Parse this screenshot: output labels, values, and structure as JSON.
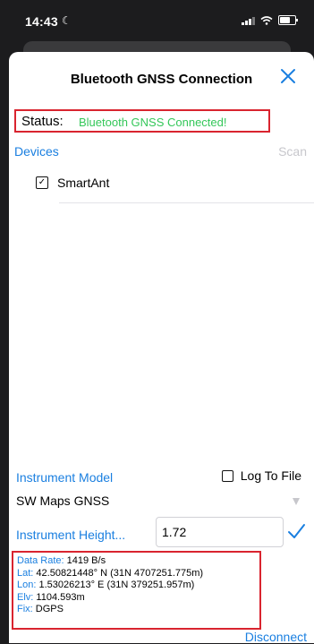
{
  "status_bar": {
    "time": "14:43"
  },
  "dialog": {
    "title": "Bluetooth GNSS Connection",
    "status_label": "Status:",
    "status_value": "Bluetooth GNSS Connected!",
    "devices_label": "Devices",
    "scan_label": "Scan",
    "devices": [
      {
        "name": "SmartAnt",
        "checked": true
      }
    ],
    "instrument_model_label": "Instrument Model",
    "log_to_file_label": "Log To File",
    "log_to_file_checked": false,
    "instrument_model_value": "SW Maps GNSS",
    "instrument_height_label": "Instrument Height...",
    "instrument_height_value": "1.72",
    "data": {
      "data_rate_label": "Data Rate:",
      "data_rate_value": "1419 B/s",
      "lat_label": "Lat:",
      "lat_value": "42.50821448° N (31N 4707251.775m)",
      "lon_label": "Lon:",
      "lon_value": "1.53026213° E (31N 379251.957m)",
      "elv_label": "Elv:",
      "elv_value": "1104.593m",
      "fix_label": "Fix:",
      "fix_value": "DGPS"
    },
    "disconnect_label": "Disconnect"
  },
  "colors": {
    "accent": "#1a7fe0",
    "connected": "#34c759",
    "highlight": "#d9242f"
  }
}
